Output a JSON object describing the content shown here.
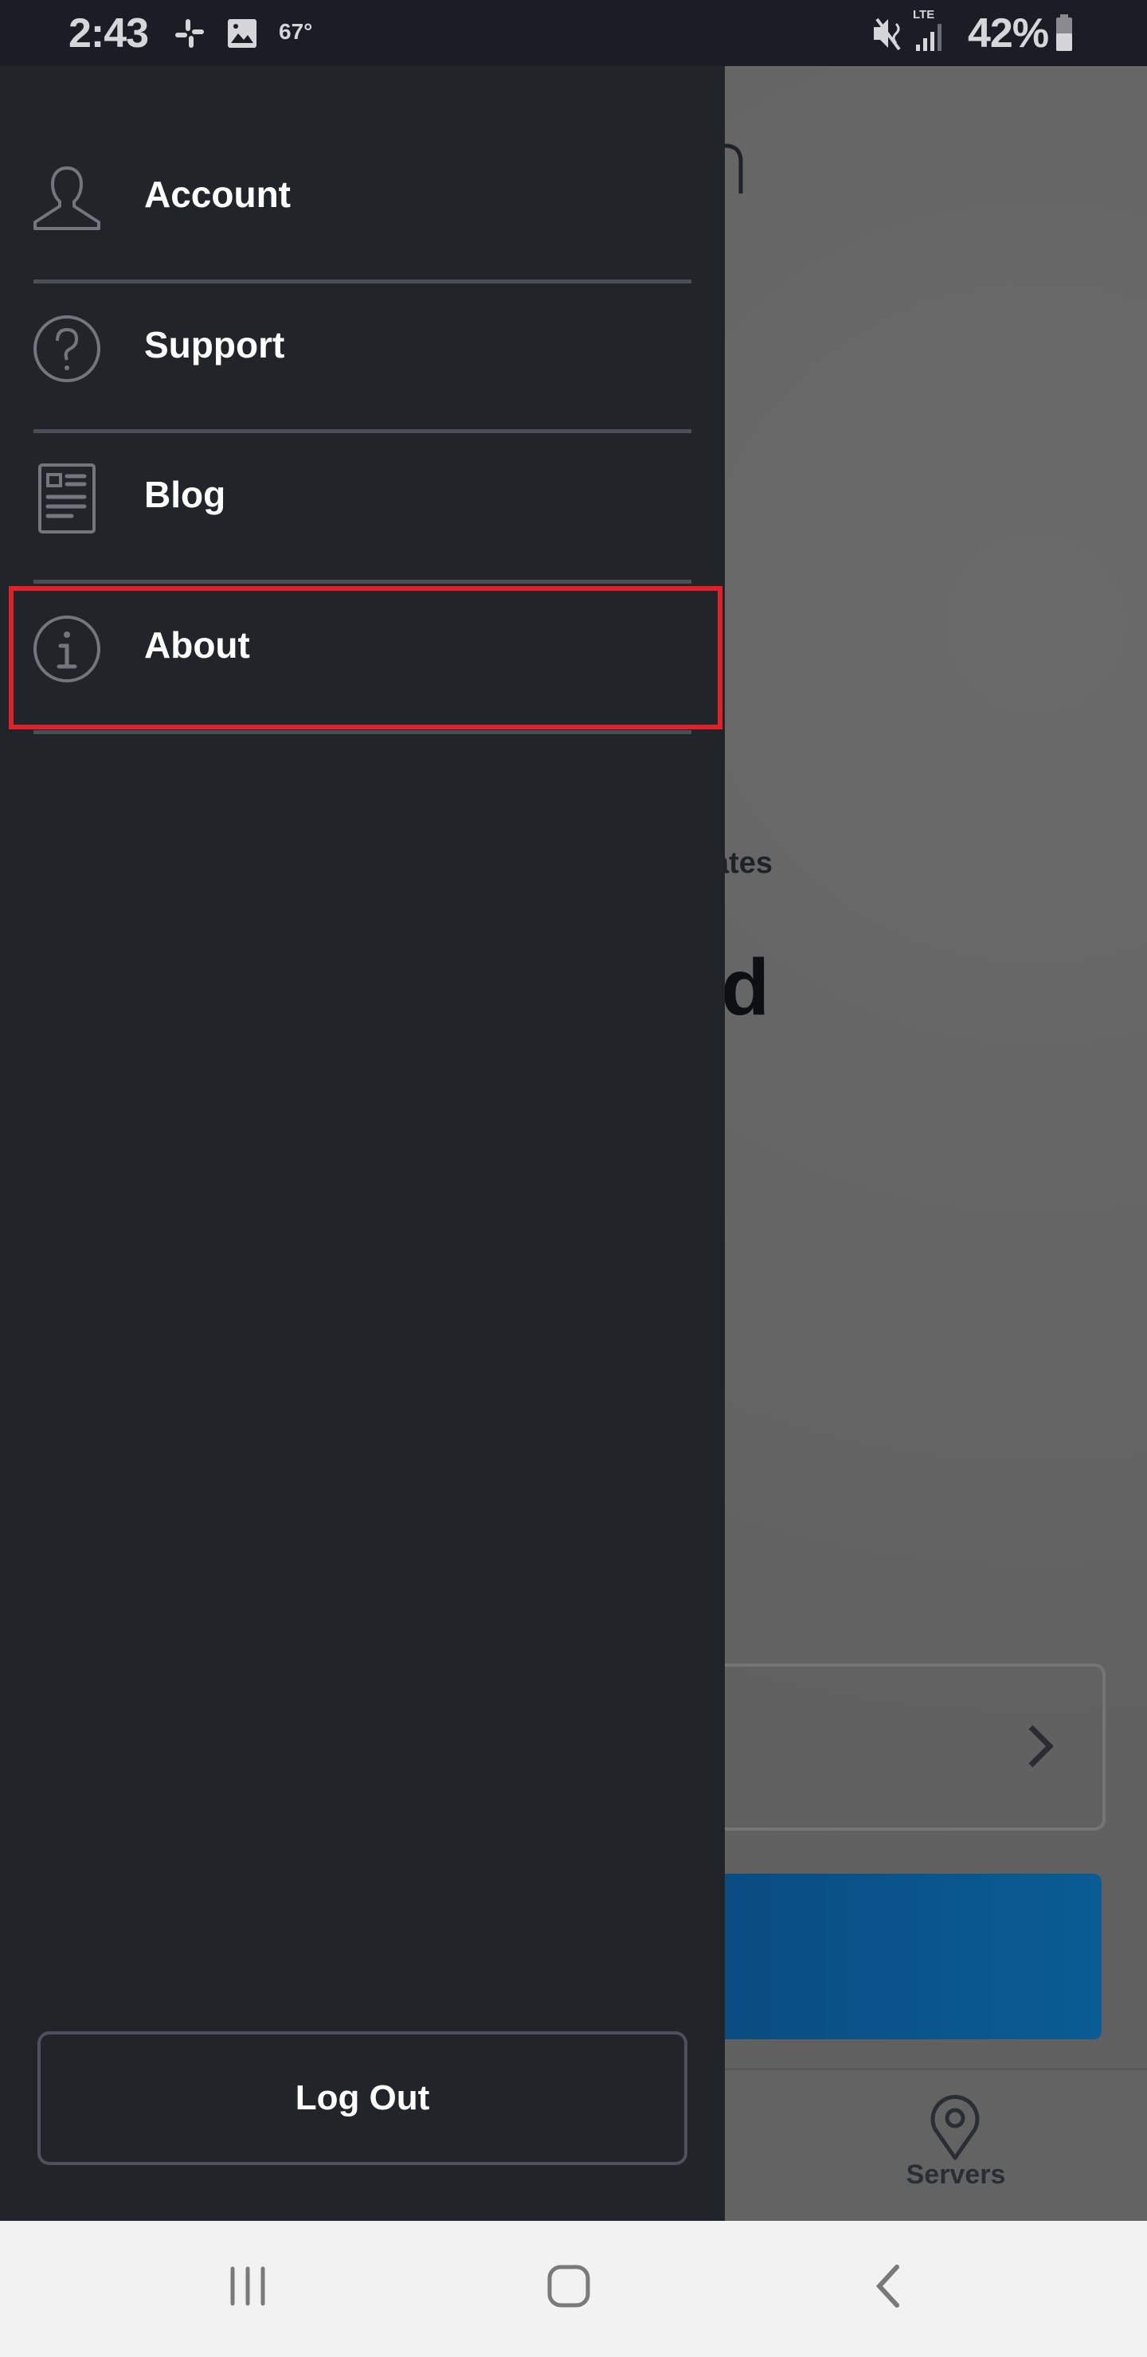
{
  "status_bar": {
    "time": "2:43",
    "temperature": "67°",
    "network": "LTE",
    "battery": "42%",
    "icons": [
      "slack-icon",
      "image-icon",
      "mute-icon",
      "signal-icon",
      "battery-icon"
    ]
  },
  "background_app": {
    "partial_subtitle": "ates",
    "partial_heading": "d",
    "bottom_nav": {
      "servers_label": "Servers"
    },
    "accent_color": "#0a5c94"
  },
  "drawer": {
    "items": [
      {
        "label": "Account",
        "icon": "user-icon"
      },
      {
        "label": "Support",
        "icon": "question-circle-icon"
      },
      {
        "label": "Blog",
        "icon": "newspaper-icon"
      },
      {
        "label": "About",
        "icon": "info-circle-icon",
        "highlighted": true
      }
    ],
    "logout_label": "Log Out",
    "highlight_color": "#e0202a"
  },
  "system_nav": {
    "buttons": [
      "recents",
      "home",
      "back"
    ]
  }
}
